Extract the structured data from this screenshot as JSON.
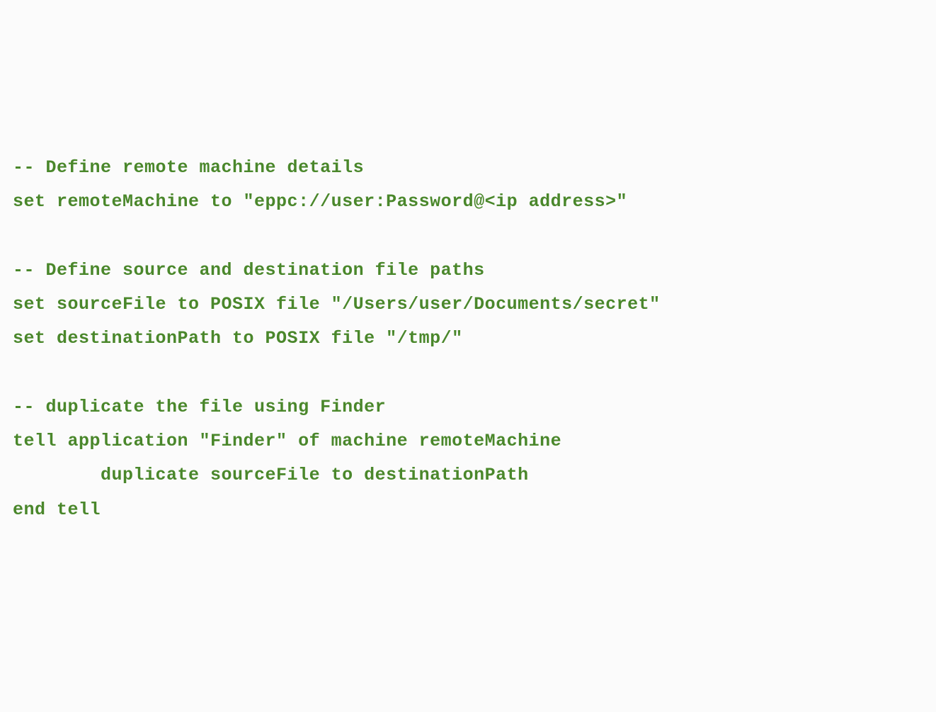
{
  "code": {
    "lines": [
      "-- Define remote machine details",
      "set remoteMachine to \"eppc://user:Password@<ip address>\"",
      "",
      "-- Define source and destination file paths",
      "set sourceFile to POSIX file \"/Users/user/Documents/secret\"",
      "set destinationPath to POSIX file \"/tmp/\"",
      "",
      "-- duplicate the file using Finder",
      "tell application \"Finder\" of machine remoteMachine",
      "        duplicate sourceFile to destinationPath",
      "end tell"
    ]
  }
}
